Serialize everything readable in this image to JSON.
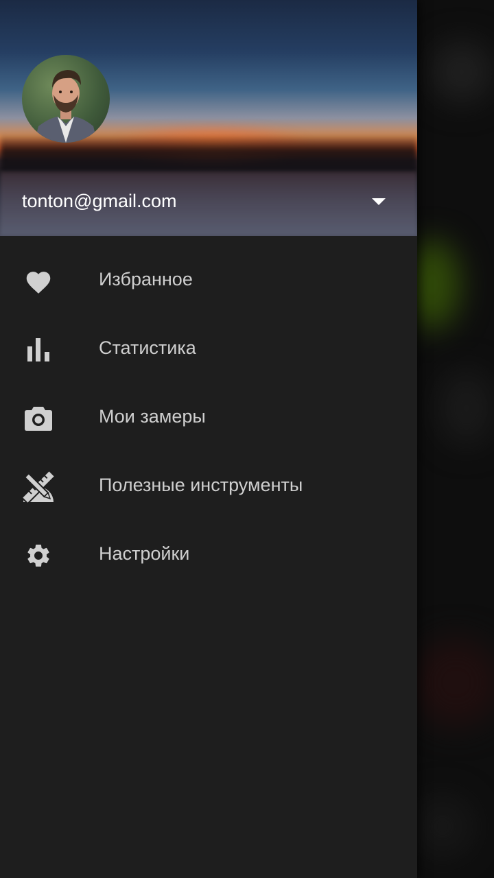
{
  "account": {
    "email": "tonton@gmail.com",
    "avatar_icon": "user-avatar-photo",
    "toggle_icon": "arrow-drop-down-icon"
  },
  "menu": {
    "items": [
      {
        "label": "Избранное",
        "icon": "heart-icon"
      },
      {
        "label": "Статистика",
        "icon": "bar-chart-icon"
      },
      {
        "label": "Мои замеры",
        "icon": "camera-icon"
      },
      {
        "label": "Полезные инструменты",
        "icon": "ruler-pencil-icon"
      },
      {
        "label": "Настройки",
        "icon": "gear-icon"
      }
    ]
  },
  "colors": {
    "drawer_bg": "#1e1e1e",
    "icon": "#d0d0d0",
    "label": "#cfcfcf",
    "email": "#ffffff"
  }
}
